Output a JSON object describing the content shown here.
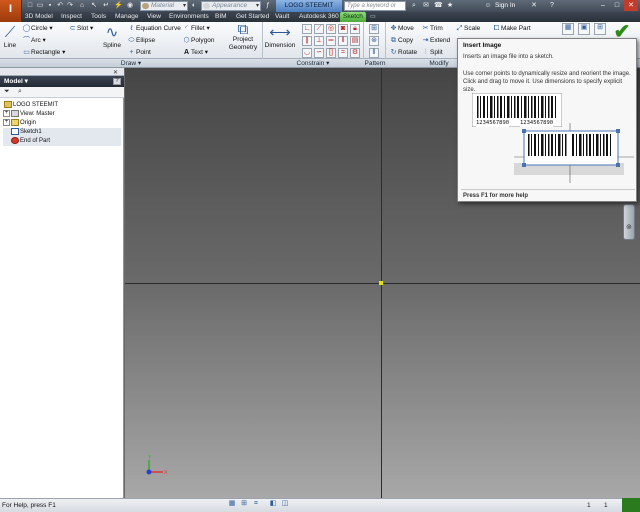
{
  "title_bar": {
    "app_letter": "I",
    "material_placeholder": "Material",
    "appearance_placeholder": "Appearance",
    "document_title": "LOGO STEEMIT",
    "search_placeholder": "Type a keyword or phrase",
    "sign_in": "Sign In"
  },
  "tabs": [
    {
      "label": "3D Model"
    },
    {
      "label": "Inspect"
    },
    {
      "label": "Tools"
    },
    {
      "label": "Manage"
    },
    {
      "label": "View"
    },
    {
      "label": "Environments"
    },
    {
      "label": "BIM"
    },
    {
      "label": "Get Started"
    },
    {
      "label": "Vault"
    },
    {
      "label": "Autodesk 360"
    },
    {
      "label": "Sketch"
    }
  ],
  "ribbon": {
    "draw": {
      "line": "Line",
      "circle": "Circle",
      "arc": "Arc",
      "rectangle": "Rectangle",
      "slot": "Slot",
      "spline": "Spline",
      "equation_curve": "Equation Curve",
      "ellipse": "Ellipse",
      "point": "Point",
      "fillet": "Fillet",
      "polygon": "Polygon",
      "text": "Text",
      "project_geometry_1": "Project",
      "project_geometry_2": "Geometry",
      "panel_label": "Draw"
    },
    "constrain": {
      "dimension": "Dimension",
      "panel_label": "Constrain"
    },
    "pattern": {
      "panel_label": "Pattern"
    },
    "modify": {
      "move": "Move",
      "copy": "Copy",
      "rotate": "Rotate",
      "trim": "Trim",
      "extend": "Extend",
      "split": "Split",
      "scale": "Scale",
      "panel_label": "Modify"
    },
    "make_part": "Make Part"
  },
  "browser": {
    "title": "Model",
    "tree": [
      {
        "label": "LOGO STEEMIT"
      },
      {
        "label": "View: Master"
      },
      {
        "label": "Origin"
      },
      {
        "label": "Sketch1"
      },
      {
        "label": "End of Part"
      }
    ]
  },
  "tooltip": {
    "title": "Insert Image",
    "description": "Inserts an image file into a sketch.",
    "details": "Use corner points to dynamically resize and reorient the image. Click and drag to move it. Use dimensions to specify explicit size.",
    "barcode_number": "1234567890",
    "barcode_number_2": "1234567890",
    "help": "Press F1 for more help"
  },
  "statusbar": {
    "text": "For Help, press F1",
    "num1": "1",
    "num2": "1"
  },
  "colors": {
    "active_tab": "#4cab3b",
    "app_button": "#c0501a",
    "origin_point": "#e6e400",
    "status_green": "#2c7a1e"
  }
}
